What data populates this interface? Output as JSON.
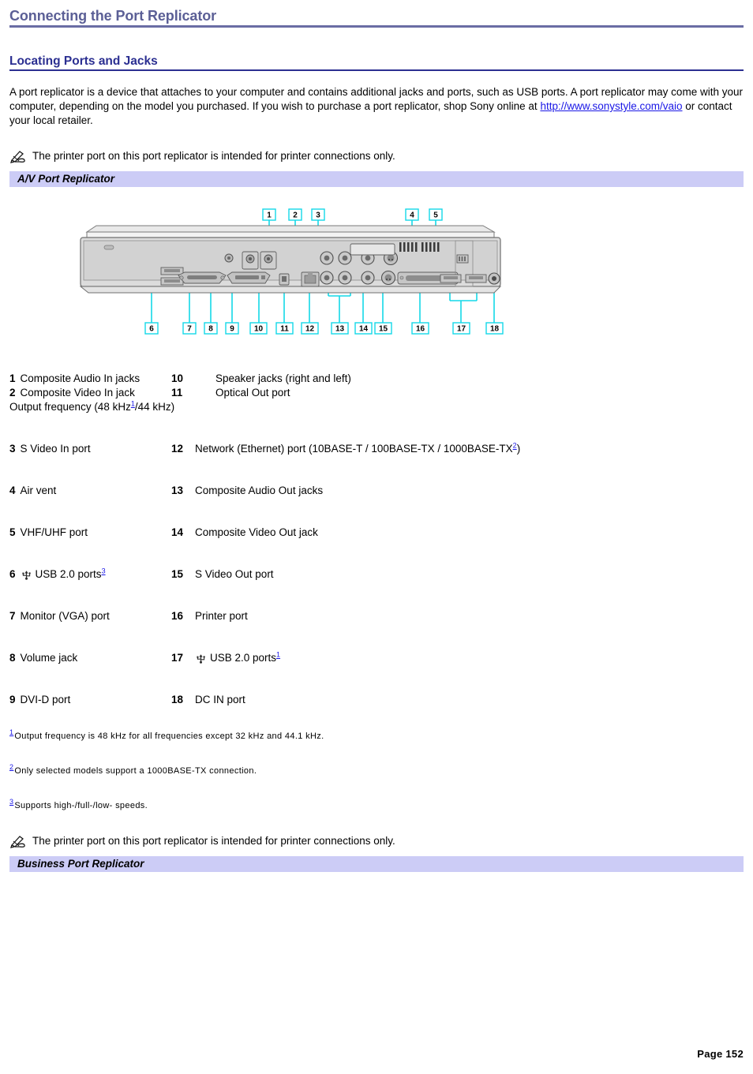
{
  "document": {
    "title": "Connecting the Port Replicator",
    "section_heading": "Locating Ports and Jacks",
    "page_number": "Page 152"
  },
  "intro": {
    "text_before_link": "A port replicator is a device that attaches to your computer and contains additional jacks and ports, such as USB ports. A port replicator may come with your computer, depending on the model you purchased. If you wish to purchase a port replicator, shop Sony online at ",
    "link_text": "http://www.sonystyle.com/vaio",
    "text_after_link": " or contact your local retailer."
  },
  "note_top": {
    "icon": "note-pencil-icon",
    "text": "The printer port on this port replicator is intended for printer connections only."
  },
  "note_bottom": {
    "icon": "note-pencil-icon",
    "text": "The printer port on this port replicator is intended for printer connections only."
  },
  "bands": {
    "av": "A/V Port Replicator",
    "business": "Business Port Replicator"
  },
  "figure": {
    "caption": "A/V port replicator rear panel with numbered callouts 1 through 18",
    "callouts_top": [
      "1",
      "2",
      "3",
      "4",
      "5"
    ],
    "callouts_bottom": [
      "6",
      "7",
      "8",
      "9",
      "10",
      "11",
      "12",
      "13",
      "14",
      "15",
      "16",
      "17",
      "18"
    ]
  },
  "ports": [
    {
      "left_num": "1",
      "left_label": "Composite Audio In jacks",
      "right_num": "10",
      "right_label": "Speaker jacks (right and left)",
      "right_pad": true
    },
    {
      "left_num": "2",
      "left_label": "Composite Video In jack",
      "right_num": "11",
      "right_label": "Optical Out port",
      "right_pad": true,
      "subline_before": "Output frequency (48 kHz",
      "subline_sup": "1",
      "subline_after": "/44 kHz)"
    },
    {
      "left_num": "3",
      "left_label": "S Video In port",
      "right_num": "12",
      "right_label_before": "Network (Ethernet) port (10BASE-T / 100BASE-TX / 1000BASE-TX",
      "right_sup": "2",
      "right_label_after": ")"
    },
    {
      "left_num": "4",
      "left_label": "Air vent",
      "right_num": "13",
      "right_label": "Composite Audio Out jacks"
    },
    {
      "left_num": "5",
      "left_label": "VHF/UHF port",
      "right_num": "14",
      "right_label": "Composite Video Out jack"
    },
    {
      "left_num": "6",
      "left_icon": "usb-icon",
      "left_label": "USB 2.0 ports",
      "left_sup": "3",
      "right_num": "15",
      "right_label": "S Video Out port"
    },
    {
      "left_num": "7",
      "left_label": "Monitor (VGA) port",
      "right_num": "16",
      "right_label": "Printer port"
    },
    {
      "left_num": "8",
      "left_label": "Volume jack",
      "right_num": "17",
      "right_icon": "usb-icon",
      "right_label": "USB 2.0 ports",
      "right_sup": "1"
    },
    {
      "left_num": "9",
      "left_label": "DVI-D port",
      "right_num": "18",
      "right_label": "DC IN port"
    }
  ],
  "footnotes": [
    {
      "num": "1",
      "text": "Output frequency is 48 kHz for all frequencies except 32 kHz and 44.1 kHz."
    },
    {
      "num": "2",
      "text": "Only selected models support a 1000BASE-TX connection."
    },
    {
      "num": "3",
      "text": "Supports high-/full-/low- speeds."
    }
  ],
  "colors": {
    "title": "#5b5f96",
    "heading": "#2b2f91",
    "band": "#ccccf6",
    "link": "#1a17e6",
    "callout": "#00d8e8"
  }
}
